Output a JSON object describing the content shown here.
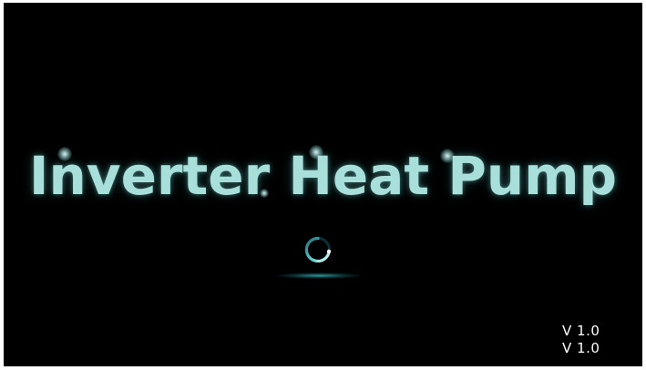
{
  "splash": {
    "title": "Inverter Heat Pump",
    "accent_color": "#a8dfda",
    "loading_icon": "loading-spinner-icon"
  },
  "version": {
    "line1": "V 1.0",
    "line2": "V 1.0"
  }
}
